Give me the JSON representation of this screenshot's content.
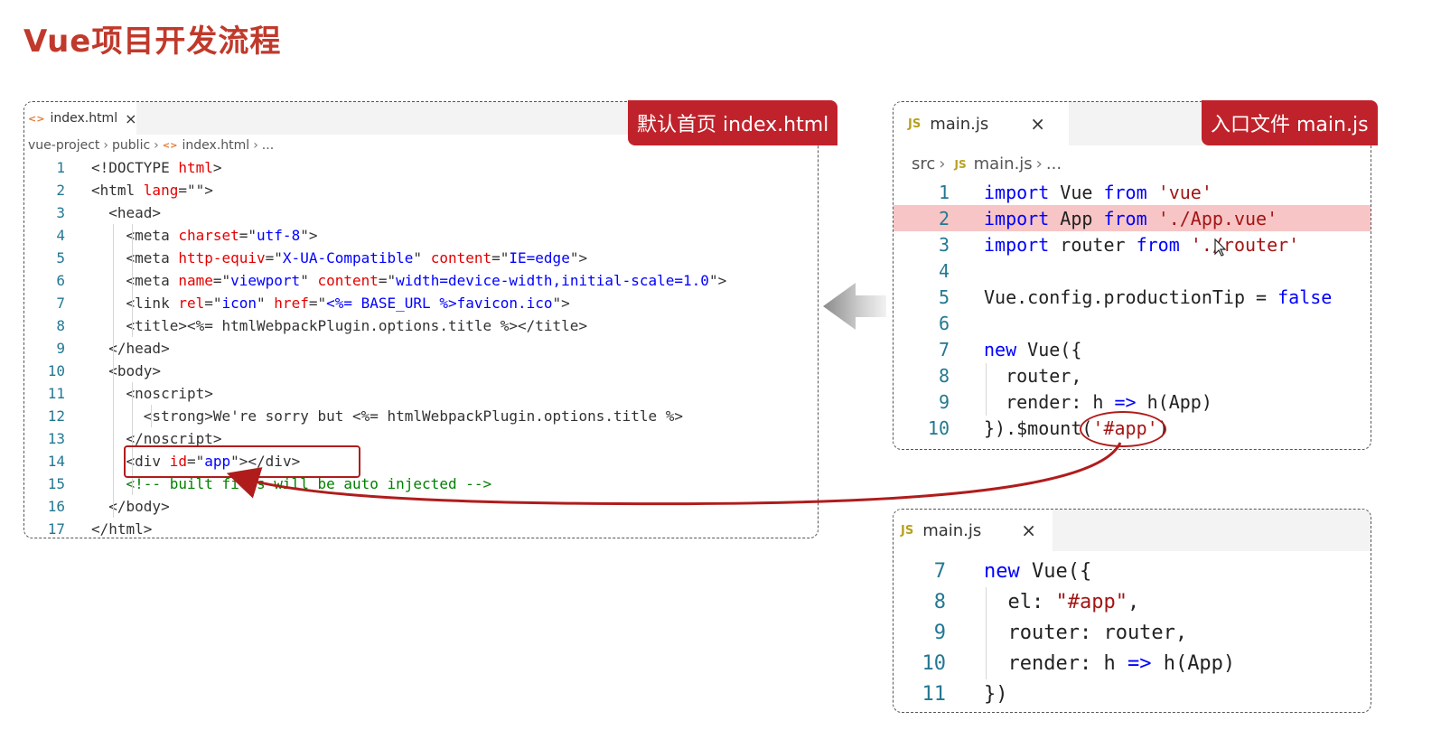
{
  "title": "Vue项目开发流程",
  "index_panel": {
    "tab_icon": "<>",
    "tab_label": "index.html",
    "close": "×",
    "badge": "默认首页 index.html",
    "breadcrumb": [
      "vue-project",
      "public",
      "index.html",
      "..."
    ],
    "lines": [
      {
        "n": "1",
        "parts": [
          [
            "k-punc",
            "<!DOCTYPE "
          ],
          [
            "k-attr",
            "html"
          ],
          [
            "k-punc",
            ">"
          ]
        ]
      },
      {
        "n": "2",
        "parts": [
          [
            "k-punc",
            "<html "
          ],
          [
            "k-attr",
            "lang"
          ],
          [
            "k-punc",
            "=\""
          ],
          [
            "k-str",
            ""
          ],
          [
            "k-punc",
            "\">"
          ]
        ]
      },
      {
        "n": "3",
        "parts": [
          [
            "k-punc",
            "  <head>"
          ]
        ]
      },
      {
        "n": "4",
        "parts": [
          [
            "k-punc",
            "    <meta "
          ],
          [
            "k-attr",
            "charset"
          ],
          [
            "k-punc",
            "=\""
          ],
          [
            "k-str",
            "utf-8"
          ],
          [
            "k-punc",
            "\">"
          ]
        ]
      },
      {
        "n": "5",
        "parts": [
          [
            "k-punc",
            "    <meta "
          ],
          [
            "k-attr",
            "http-equiv"
          ],
          [
            "k-punc",
            "=\""
          ],
          [
            "k-str",
            "X-UA-Compatible"
          ],
          [
            "k-punc",
            "\" "
          ],
          [
            "k-attr",
            "content"
          ],
          [
            "k-punc",
            "=\""
          ],
          [
            "k-str",
            "IE=edge"
          ],
          [
            "k-punc",
            "\">"
          ]
        ]
      },
      {
        "n": "6",
        "parts": [
          [
            "k-punc",
            "    <meta "
          ],
          [
            "k-attr",
            "name"
          ],
          [
            "k-punc",
            "=\""
          ],
          [
            "k-str",
            "viewport"
          ],
          [
            "k-punc",
            "\" "
          ],
          [
            "k-attr",
            "content"
          ],
          [
            "k-punc",
            "=\""
          ],
          [
            "k-str",
            "width=device-width,initial-scale=1.0"
          ],
          [
            "k-punc",
            "\">"
          ]
        ]
      },
      {
        "n": "7",
        "parts": [
          [
            "k-punc",
            "    <link "
          ],
          [
            "k-attr",
            "rel"
          ],
          [
            "k-punc",
            "=\""
          ],
          [
            "k-str",
            "icon"
          ],
          [
            "k-punc",
            "\" "
          ],
          [
            "k-attr",
            "href"
          ],
          [
            "k-punc",
            "=\""
          ],
          [
            "k-str",
            "<%= BASE_URL %>favicon.ico"
          ],
          [
            "k-punc",
            "\">"
          ]
        ]
      },
      {
        "n": "8",
        "parts": [
          [
            "k-punc",
            "    <title><%= htmlWebpackPlugin.options.title %></title>"
          ]
        ]
      },
      {
        "n": "9",
        "parts": [
          [
            "k-punc",
            "  </head>"
          ]
        ]
      },
      {
        "n": "10",
        "parts": [
          [
            "k-punc",
            "  <body>"
          ]
        ]
      },
      {
        "n": "11",
        "parts": [
          [
            "k-punc",
            "    <noscript>"
          ]
        ]
      },
      {
        "n": "12",
        "parts": [
          [
            "k-punc",
            "      <strong>We're sorry but <%= htmlWebpackPlugin.options.title %>"
          ]
        ]
      },
      {
        "n": "13",
        "parts": [
          [
            "k-punc",
            "    </noscript>"
          ]
        ]
      },
      {
        "n": "14",
        "parts": [
          [
            "k-punc",
            "    <div "
          ],
          [
            "k-attr",
            "id"
          ],
          [
            "k-punc",
            "=\""
          ],
          [
            "k-str",
            "app"
          ],
          [
            "k-punc",
            "\"></div>"
          ]
        ]
      },
      {
        "n": "15",
        "parts": [
          [
            "k-com",
            "    <!-- built files will be auto injected -->"
          ]
        ]
      },
      {
        "n": "16",
        "parts": [
          [
            "k-punc",
            "  </body>"
          ]
        ]
      },
      {
        "n": "17",
        "parts": [
          [
            "k-punc",
            "</html>"
          ]
        ]
      }
    ]
  },
  "main_panel": {
    "tab_icon": "JS",
    "tab_label": "main.js",
    "close": "×",
    "badge": "入口文件 main.js",
    "breadcrumb": [
      "src",
      "JS",
      "main.js",
      "..."
    ],
    "lines": [
      {
        "n": "1",
        "parts": [
          [
            "k-kw",
            "import "
          ],
          [
            "k-plain",
            "Vue "
          ],
          [
            "k-kw",
            "from "
          ],
          [
            "k-js-str",
            "'vue'"
          ]
        ]
      },
      {
        "n": "2",
        "parts": [
          [
            "k-kw",
            "import "
          ],
          [
            "k-plain",
            "App "
          ],
          [
            "k-kw",
            "from "
          ],
          [
            "k-js-str",
            "'./App.vue'"
          ]
        ]
      },
      {
        "n": "3",
        "parts": [
          [
            "k-kw",
            "import "
          ],
          [
            "k-plain",
            "router "
          ],
          [
            "k-kw",
            "from "
          ],
          [
            "k-js-str",
            "'./router'"
          ]
        ]
      },
      {
        "n": "4",
        "parts": []
      },
      {
        "n": "5",
        "parts": [
          [
            "k-plain",
            "Vue.config.productionTip = "
          ],
          [
            "k-kw",
            "false"
          ]
        ]
      },
      {
        "n": "6",
        "parts": []
      },
      {
        "n": "7",
        "parts": [
          [
            "k-kw",
            "new "
          ],
          [
            "k-plain",
            "Vue({"
          ]
        ]
      },
      {
        "n": "8",
        "parts": [
          [
            "k-plain",
            "  router,"
          ]
        ]
      },
      {
        "n": "9",
        "parts": [
          [
            "k-plain",
            "  render: h "
          ],
          [
            "k-kw",
            "=>"
          ],
          [
            "k-plain",
            " h(App)"
          ]
        ]
      },
      {
        "n": "10",
        "parts": [
          [
            "k-plain",
            "}).$mount("
          ],
          [
            "k-js-str",
            "'#app'"
          ],
          [
            "k-plain",
            ")"
          ]
        ]
      }
    ]
  },
  "alt_panel": {
    "tab_icon": "JS",
    "tab_label": "main.js",
    "close": "×",
    "lines": [
      {
        "n": "7",
        "parts": [
          [
            "k-kw",
            "new "
          ],
          [
            "k-plain",
            "Vue({"
          ]
        ]
      },
      {
        "n": "8",
        "parts": [
          [
            "k-plain",
            "  el: "
          ],
          [
            "k-js-str",
            "\"#app\""
          ],
          [
            "k-plain",
            ","
          ]
        ]
      },
      {
        "n": "9",
        "parts": [
          [
            "k-plain",
            "  router: router,"
          ]
        ]
      },
      {
        "n": "10",
        "parts": [
          [
            "k-plain",
            "  render: h "
          ],
          [
            "k-kw",
            "=>"
          ],
          [
            "k-plain",
            " h(App)"
          ]
        ]
      },
      {
        "n": "11",
        "parts": [
          [
            "k-plain",
            "})"
          ]
        ]
      }
    ]
  },
  "colors": {
    "accent_red": "#c0222b",
    "highlight_row": "#f7c5c5"
  },
  "icons": [
    "html-file-icon",
    "js-file-icon",
    "close-icon",
    "left-arrow-icon",
    "mouse-cursor-icon"
  ]
}
